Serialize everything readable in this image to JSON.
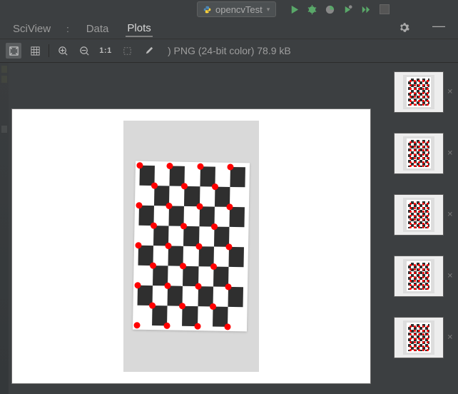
{
  "topbar": {
    "run_config": "opencvTest"
  },
  "tabs": {
    "title": "SciView",
    "data": "Data",
    "plots": "Plots"
  },
  "toolbar": {
    "scale_label": "1:1",
    "meta": ") PNG (24-bit color) 78.9 kB"
  },
  "thumbs": {
    "count": 5
  }
}
